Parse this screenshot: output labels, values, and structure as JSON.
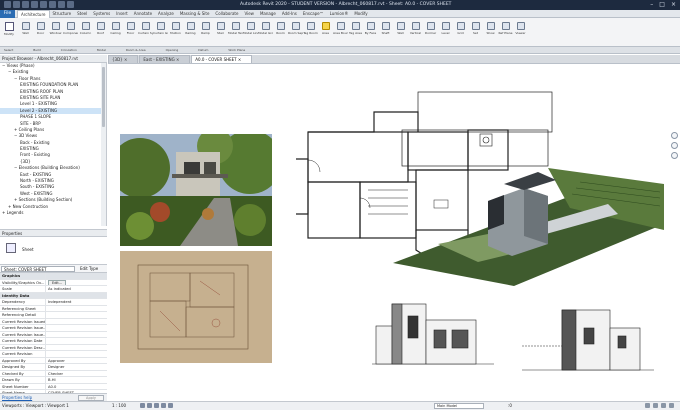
{
  "app": {
    "title": "Autodesk Revit 2020 - STUDENT VERSION - Albrecht_060817.rvt - Sheet: A0.0 - COVER SHEET"
  },
  "ribbon": {
    "file_tab": "File",
    "tabs": [
      "Architecture",
      "Structure",
      "Steel",
      "Systems",
      "Insert",
      "Annotate",
      "Analyze",
      "Massing & Site",
      "Collaborate",
      "View",
      "Manage",
      "Add-Ins",
      "Enscape™",
      "Lumion®",
      "Modify"
    ],
    "active_tab": "Architecture",
    "modify_label": "Modify",
    "tools": [
      "Wall",
      "Door",
      "Window",
      "Component",
      "Column",
      "Roof",
      "Ceiling",
      "Floor",
      "Curtain System",
      "Curtain Grid",
      "Mullion",
      "Railing",
      "Ramp",
      "Stair",
      "Model Text",
      "Model Line",
      "Model Group",
      "Room",
      "Room Separator",
      "Tag Room",
      "Area",
      "Area Boundary",
      "Tag Area",
      "By Face",
      "Shaft",
      "Wall",
      "Vertical",
      "Dormer",
      "Level",
      "Grid",
      "Set",
      "Show",
      "Ref Plane",
      "Viewer"
    ],
    "panels": [
      "Select",
      "Build",
      "Circulation",
      "Model",
      "Room & Area",
      "Opening",
      "Datum",
      "Work Plane"
    ]
  },
  "project_browser": {
    "title": "Project Browser - Albrecht_060817.rvt",
    "items": [
      {
        "label": "Views (Phase)",
        "indent": 0,
        "sign": "−"
      },
      {
        "label": "Existing",
        "indent": 1,
        "sign": "−"
      },
      {
        "label": "Floor Plans",
        "indent": 2,
        "sign": "−"
      },
      {
        "label": "EXISTING FOUNDATION PLAN",
        "indent": 3,
        "sign": ""
      },
      {
        "label": "EXISTING ROOF PLAN",
        "indent": 3,
        "sign": ""
      },
      {
        "label": "EXISTING SITE PLAN",
        "indent": 3,
        "sign": ""
      },
      {
        "label": "Level 1 - EXISTING",
        "indent": 3,
        "sign": ""
      },
      {
        "label": "Level 2 - EXISTING",
        "indent": 3,
        "sign": "",
        "selected": true
      },
      {
        "label": "PHASE 1 SLOPE",
        "indent": 3,
        "sign": ""
      },
      {
        "label": "SITE - BRP",
        "indent": 3,
        "sign": ""
      },
      {
        "label": "Ceiling Plans",
        "indent": 2,
        "sign": "+"
      },
      {
        "label": "3D Views",
        "indent": 2,
        "sign": "−"
      },
      {
        "label": "Back - Existing",
        "indent": 3,
        "sign": ""
      },
      {
        "label": "EXISTING",
        "indent": 3,
        "sign": ""
      },
      {
        "label": "Front - Existing",
        "indent": 3,
        "sign": ""
      },
      {
        "label": "{3D}",
        "indent": 3,
        "sign": ""
      },
      {
        "label": "Elevations (Building Elevation)",
        "indent": 2,
        "sign": "−"
      },
      {
        "label": "East - EXISTING",
        "indent": 3,
        "sign": ""
      },
      {
        "label": "North - EXISTING",
        "indent": 3,
        "sign": ""
      },
      {
        "label": "South - EXISTING",
        "indent": 3,
        "sign": ""
      },
      {
        "label": "West - EXISTING",
        "indent": 3,
        "sign": ""
      },
      {
        "label": "Sections (Building Section)",
        "indent": 2,
        "sign": "+"
      },
      {
        "label": "New Construction",
        "indent": 1,
        "sign": "+"
      },
      {
        "label": "Legends",
        "indent": 0,
        "sign": "+"
      }
    ]
  },
  "properties": {
    "title": "Properties",
    "type_name": "Sheet",
    "instance_selector": "Sheet: COVER SHEET",
    "edit_type": "Edit Type",
    "rows": [
      {
        "k": "Graphics",
        "v": "",
        "group": true
      },
      {
        "k": "Visibility/Graphics Ov...",
        "v": "Edit...",
        "btn": true
      },
      {
        "k": "Scale",
        "v": "As indicated"
      },
      {
        "k": "Identity Data",
        "v": "",
        "group": true
      },
      {
        "k": "Dependency",
        "v": "Independent"
      },
      {
        "k": "Referencing Sheet",
        "v": ""
      },
      {
        "k": "Referencing Detail",
        "v": ""
      },
      {
        "k": "Current Revision Issued",
        "v": ""
      },
      {
        "k": "Current Revision Issue...",
        "v": ""
      },
      {
        "k": "Current Revision Issue...",
        "v": ""
      },
      {
        "k": "Current Revision Date",
        "v": ""
      },
      {
        "k": "Current Revision Desc...",
        "v": ""
      },
      {
        "k": "Current Revision",
        "v": ""
      },
      {
        "k": "Approved By",
        "v": "Approver"
      },
      {
        "k": "Designed By",
        "v": "Designer"
      },
      {
        "k": "Checked By",
        "v": "Checker"
      },
      {
        "k": "Drawn By",
        "v": "B.HI"
      },
      {
        "k": "Sheet Number",
        "v": "A0.0"
      },
      {
        "k": "Sheet Name",
        "v": "COVER SHEET"
      }
    ],
    "help_link": "Properties help",
    "apply": "Apply"
  },
  "view_tabs": [
    "{3D}",
    "East - EXISTING",
    "A0.0 - COVER SHEET"
  ],
  "active_view_tab": 2,
  "status": {
    "left": "Viewports : Viewport : Viewport 1",
    "scale": "1 : 100",
    "model": "Main Model",
    "zero": ":0"
  }
}
